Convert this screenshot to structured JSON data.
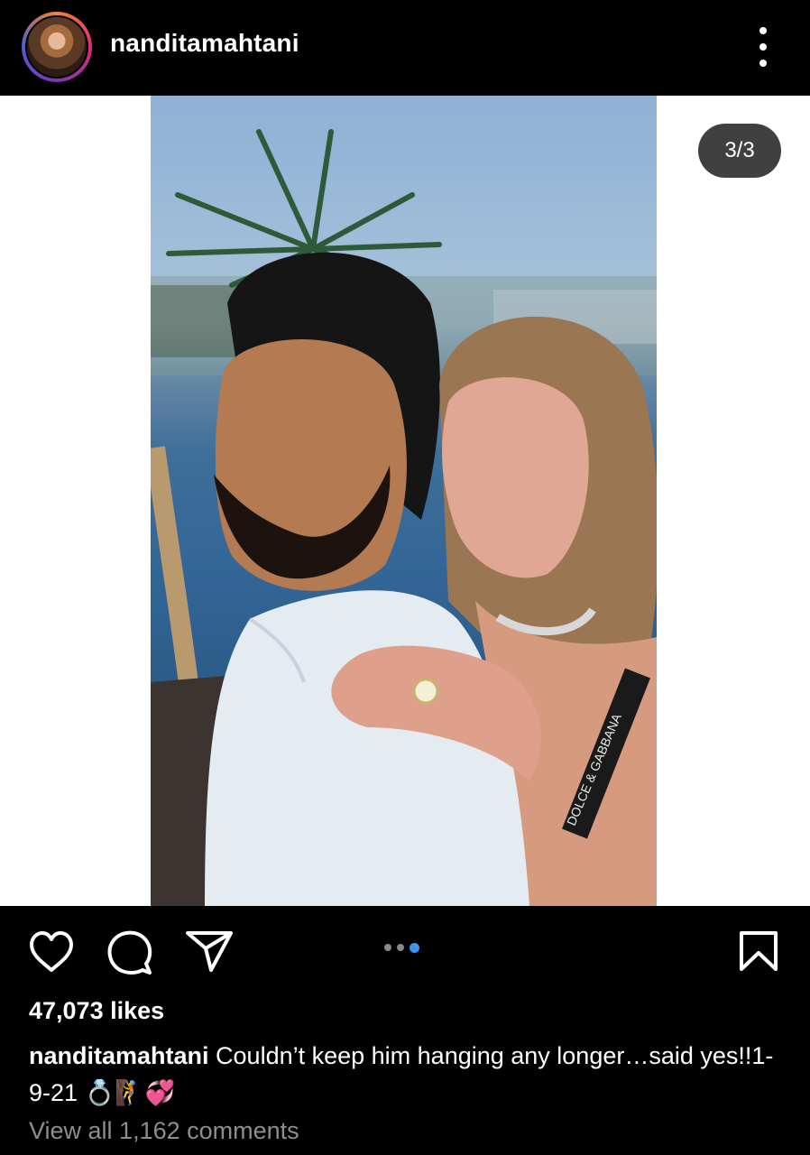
{
  "header": {
    "username": "nanditamahtani"
  },
  "post": {
    "page_indicator": "3/3",
    "carousel_total": 3,
    "carousel_active": 3,
    "photo_text": "DOLCE & GABBANA"
  },
  "actions": {
    "like_icon": "heart-icon",
    "comment_icon": "comment-icon",
    "share_icon": "send-icon",
    "save_icon": "bookmark-icon"
  },
  "likes": "47,073 likes",
  "caption": {
    "username": "nanditamahtani",
    "text": "Couldn’t keep him hanging any longer…said yes!!1-9-21",
    "emojis": "💍🧗💞"
  },
  "comments_link": "View all 1,162 comments",
  "colors": {
    "background": "#000000",
    "carousel_active_dot": "#3897f0",
    "muted_text": "#8e8e8e"
  }
}
